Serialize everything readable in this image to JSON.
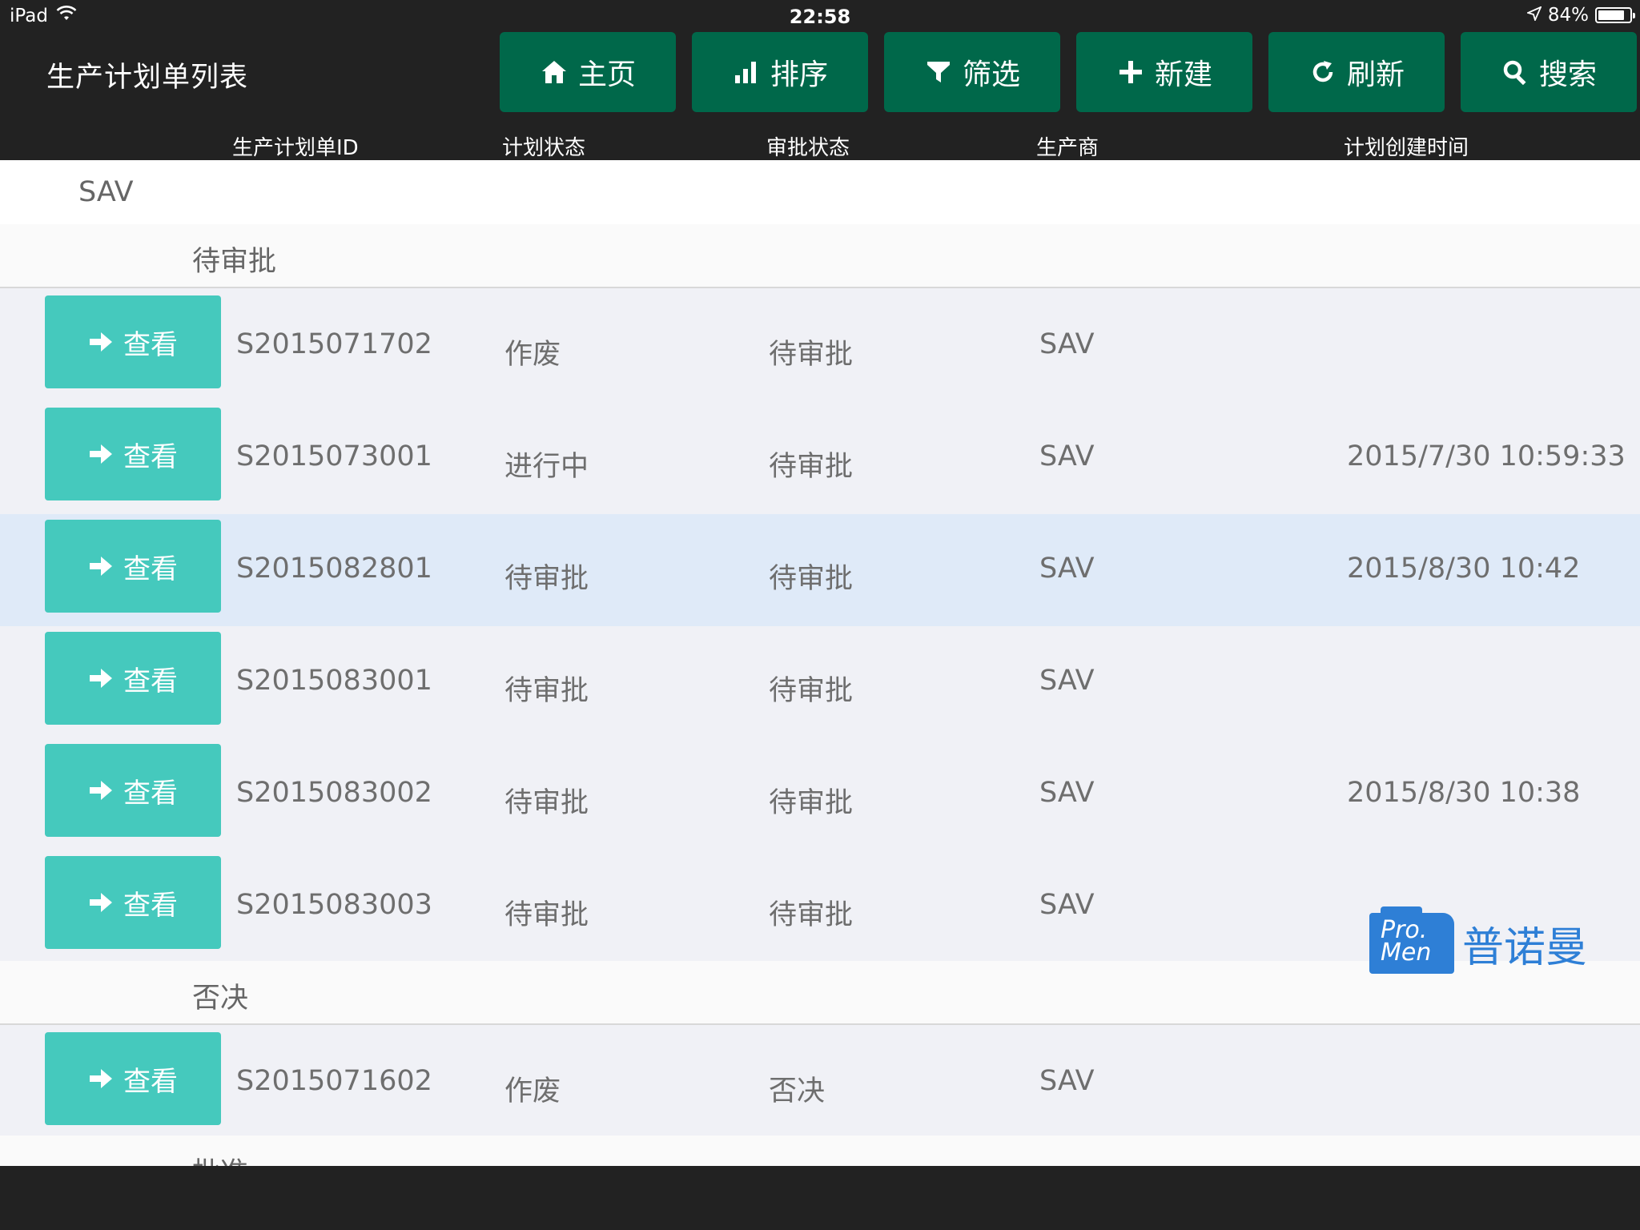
{
  "status_bar": {
    "device": "iPad",
    "time": "22:58",
    "battery": "84%",
    "battery_level": 0.84
  },
  "header": {
    "title": "生产计划单列表",
    "buttons": [
      {
        "label": "主页",
        "icon": "home-icon"
      },
      {
        "label": "排序",
        "icon": "bar-chart-icon"
      },
      {
        "label": "筛选",
        "icon": "filter-icon"
      },
      {
        "label": "新建",
        "icon": "plus-icon"
      },
      {
        "label": "刷新",
        "icon": "refresh-icon"
      },
      {
        "label": "搜索",
        "icon": "search-icon"
      }
    ],
    "columns": {
      "id": "生产计划单ID",
      "plan_status": "计划状态",
      "approval_status": "审批状态",
      "manufacturer": "生产商",
      "created_time": "计划创建时间"
    }
  },
  "group": {
    "name": "SAV"
  },
  "view_label": "查看",
  "sections": [
    {
      "name": "待审批",
      "rows": [
        {
          "id": "S2015071702",
          "plan_status": "作废",
          "approval_status": "待审批",
          "manufacturer": "SAV",
          "created_time": ""
        },
        {
          "id": "S2015073001",
          "plan_status": "进行中",
          "approval_status": "待审批",
          "manufacturer": "SAV",
          "created_time": "2015/7/30 10:59:33"
        },
        {
          "id": "S2015082801",
          "plan_status": "待审批",
          "approval_status": "待审批",
          "manufacturer": "SAV",
          "created_time": "2015/8/30 10:42",
          "selected": true
        },
        {
          "id": "S2015083001",
          "plan_status": "待审批",
          "approval_status": "待审批",
          "manufacturer": "SAV",
          "created_time": ""
        },
        {
          "id": "S2015083002",
          "plan_status": "待审批",
          "approval_status": "待审批",
          "manufacturer": "SAV",
          "created_time": "2015/8/30 10:38"
        },
        {
          "id": "S2015083003",
          "plan_status": "待审批",
          "approval_status": "待审批",
          "manufacturer": "SAV",
          "created_time": ""
        }
      ]
    },
    {
      "name": "否决",
      "rows": [
        {
          "id": "S2015071602",
          "plan_status": "作废",
          "approval_status": "否决",
          "manufacturer": "SAV",
          "created_time": ""
        }
      ]
    },
    {
      "name": "批准",
      "rows": []
    }
  ],
  "logo": {
    "mark": "Pro. Men",
    "text": "普诺曼"
  },
  "colors": {
    "header_bg": "#222222",
    "toolbar_button": "#00684a",
    "view_button": "#45c9bd",
    "row_bg": "#f0f1f6",
    "row_selected": "#dfeaf8",
    "logo_blue": "#2e7fd6"
  }
}
